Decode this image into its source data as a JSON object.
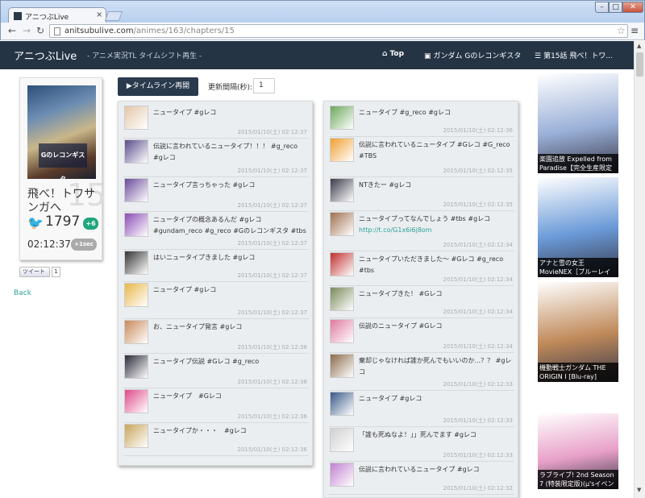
{
  "browser": {
    "tab_title": "アニつぶLive",
    "tab_close": "×",
    "url_host": "anitsubulive.com",
    "url_path": "/animes/163/chapters/15",
    "window_buttons": {
      "minimize": "–",
      "maximize": "□",
      "close": "✕"
    }
  },
  "nav": {
    "brand": "アニつぶLive",
    "subtitle": "- アニメ実況TL タイムシフト再生 -",
    "links": {
      "top": "Top",
      "anime": "ガンダム Gのレコンギスタ",
      "chapter": "第15話 飛べ！トワ..."
    }
  },
  "info": {
    "episode_number": "15",
    "title": "飛べ！トワサンガへ",
    "poster_text": "Gのレコンギスタ",
    "tweet_count": "1797",
    "tweet_delta": "+6",
    "clock": "02:12:37",
    "plus_sec": "+1sec",
    "tweet_button": "ツイート",
    "tweet_button_count": "1",
    "back": "Back"
  },
  "controls": {
    "resume_button": "▶タイムライン再開",
    "interval_label": "更新間隔(秒):",
    "interval_value": "1"
  },
  "timeline": {
    "col1": [
      {
        "text": "ニュータイプ #gレコ",
        "time": "2015/01/10(土) 02:12:37",
        "color": "#e3c6a8"
      },
      {
        "text": "伝説に言われているニュータイプ！！！ #g_reco #gレコ",
        "time": "2015/01/10(土) 02:12:37",
        "color": "#5a4c8a"
      },
      {
        "text": "ニュータイプ言っちゃった #gレコ",
        "time": "2015/01/10(土) 02:12:37",
        "color": "#6a4a9a"
      },
      {
        "text": "ニュータイプの概念あるんだ #gレコ #gundam_reco #g_reco #Gのレコンギスタ #tbs",
        "time": "2015/01/10(土) 02:12:37",
        "color": "#8a4bb5"
      },
      {
        "text": "はいニュータイプきました #gレコ",
        "time": "2015/01/10(土) 02:12:37",
        "color": "#333333"
      },
      {
        "text": "ニュータイプ #gレコ",
        "time": "2015/01/10(土) 02:12:37",
        "color": "#e8b84a"
      },
      {
        "text": "お、ニュータイプ発言 #gレコ",
        "time": "2015/01/10(土) 02:12:36",
        "color": "#c98a5a"
      },
      {
        "text": "ニュータイプ伝説 #Gレコ #g_reco",
        "time": "2015/01/10(土) 02:12:36",
        "color": "#2a2a3a"
      },
      {
        "text": "ニュータイプ　#Gレコ",
        "time": "2015/01/10(土) 02:12:36",
        "color": "#e04a8a"
      },
      {
        "text": "ニュータイプか・・・　#gレコ",
        "time": "2015/01/10(土) 02:12:36",
        "color": "#c9a55a"
      }
    ],
    "col2": [
      {
        "text": "ニュータイプ #g_reco #gレコ",
        "time": "2015/01/10(土) 02:12:36",
        "color": "#6aa85a",
        "link": ""
      },
      {
        "text": "伝説に言われているニュータイプ #Gレコ #G_reco #TBS",
        "time": "2015/01/10(土) 02:12:35",
        "color": "#f0a030",
        "link": ""
      },
      {
        "text": "NTきたー #gレコ",
        "time": "2015/01/10(土) 02:12:35",
        "color": "#3a3a4a",
        "link": ""
      },
      {
        "text": "ニュータイプってなんでしょう #tbs #gレコ",
        "time": "2015/01/10(土) 02:12:34",
        "color": "#a07050",
        "link": "http://t.co/G1x6i6j8om"
      },
      {
        "text": "ニュータイプいただきました～ #Gレコ #g_reco #tbs",
        "time": "2015/01/10(土) 02:12:34",
        "color": "#c03030",
        "link": ""
      },
      {
        "text": "ニュータイプきた！ #Gレコ",
        "time": "2015/01/10(土) 02:12:34",
        "color": "#7a8a5a",
        "link": ""
      },
      {
        "text": "伝説のニュータイプ #Gレコ",
        "time": "2015/01/10(土) 02:12:34",
        "color": "#e07aa0",
        "link": ""
      },
      {
        "text": "棄却じゃなければ誰か死んでもいいのか...？？ #gレコ",
        "time": "2015/01/10(土) 02:12:33",
        "color": "#8a6a4a",
        "link": ""
      },
      {
        "text": "ニュータイプ #gレコ",
        "time": "2015/01/10(土) 02:12:33",
        "color": "#3a5a8a",
        "link": ""
      },
      {
        "text": "「誰も死ぬなよ！」」死んでます #gレコ",
        "time": "2015/01/10(土) 02:12:33",
        "color": "#d0d0d0",
        "link": ""
      },
      {
        "text": "伝説に言われているニュータイプ #gレコ",
        "time": "2015/01/10(土) 02:12:32",
        "color": "#c080d0",
        "link": ""
      }
    ]
  },
  "ads": [
    {
      "caption": "楽園追放 Expelled from Paradise【完全生産限定",
      "color": "#9ab0d8"
    },
    {
      "caption": "アナと雪の女王 MovieNEX［ブルーレイ",
      "color": "#6a9ad8"
    },
    {
      "caption": "機動戦士ガンダム THE ORIGIN I [Blu-ray]",
      "color": "#c08a5a"
    },
    {
      "caption": "ラブライブ! 2nd Season 7 (特装限定版)(μ'sイベン",
      "color": "#e8a0c8"
    }
  ]
}
